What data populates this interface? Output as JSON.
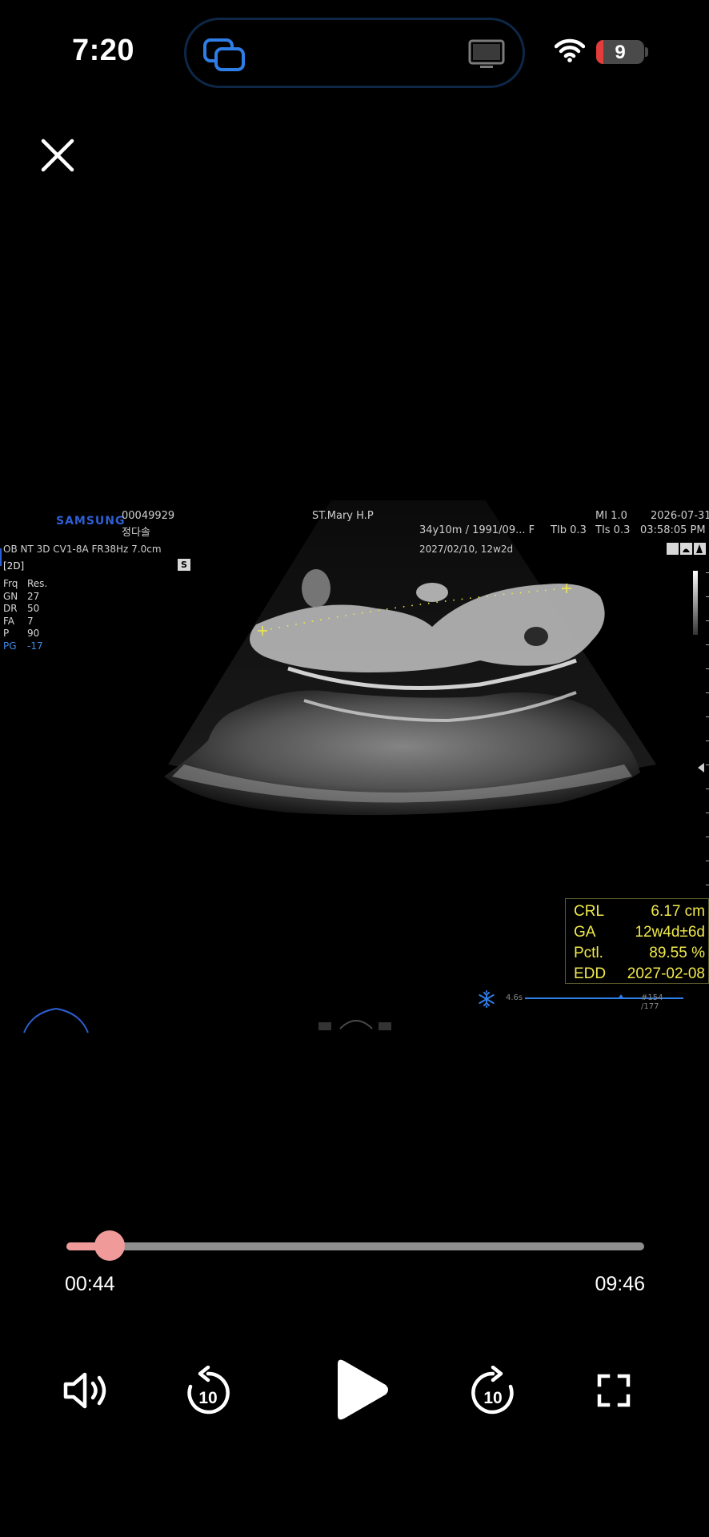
{
  "status_bar": {
    "time": "7:20",
    "battery_level": "9",
    "battery_fraction": 0.15,
    "icons": [
      "screen-mirror-icon",
      "tv-icon",
      "wifi-icon",
      "battery-icon"
    ]
  },
  "player": {
    "close_icon": "close-icon",
    "current_time": "00:44",
    "total_time": "09:46",
    "progress": 0.075,
    "colors": {
      "accent": "#f19a9a",
      "track": "#8e8e8e"
    },
    "controls": [
      "volume-icon",
      "rewind-10-icon",
      "play-icon",
      "forward-10-icon",
      "fullscreen-icon"
    ],
    "skip_seconds_label": "10"
  },
  "ultrasound": {
    "brand": "SAMSUNG",
    "patient_id": "00049929",
    "patient_name": "정다솔",
    "hospital": "ST.Mary H.P",
    "mi": "MI  1.0",
    "date": "2026-07-31",
    "patient_info": "34y10m / 1991/09...   F",
    "tib": "TIb 0.3",
    "tis": "TIs 0.3",
    "clock": "03:58:05 PM",
    "mode_line": "OB  NT 3D  CV1-8A  FR38Hz  7.0cm",
    "lmp_line": "2027/02/10, 12w2d",
    "mode": "[2D]",
    "s_badge": "S",
    "params": [
      {
        "k": "Frq",
        "v": "Res."
      },
      {
        "k": "GN",
        "v": "27"
      },
      {
        "k": "DR",
        "v": "50"
      },
      {
        "k": "FA",
        "v": "7"
      },
      {
        "k": "P",
        "v": "90"
      },
      {
        "k": "PG",
        "v": "-17"
      }
    ],
    "measurements": [
      {
        "k": "CRL",
        "v": "6.17   cm"
      },
      {
        "k": "GA",
        "v": "12w4d±6d"
      },
      {
        "k": "Pctl.",
        "v": "89.55   %"
      },
      {
        "k": "EDD",
        "v": "2027-02-08"
      }
    ],
    "cine_time": "4.6s",
    "cine_frame": "#154 /177",
    "freeze_icon": "snowflake-icon"
  }
}
